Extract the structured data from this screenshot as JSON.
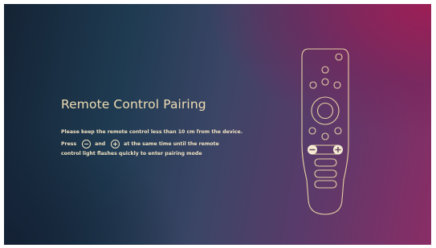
{
  "screen": {
    "title": "Remote Control Pairing",
    "instructions": {
      "line1": "Please keep the remote control less than 10 cm from the device.",
      "line2_before": "Press",
      "line2_between": "and",
      "line2_after": "at the same time until the remote",
      "line3": "control light flashes quickly to enter pairing mode"
    },
    "icons": {
      "minus": "minus-circle-icon",
      "plus": "plus-circle-icon",
      "remote": "remote-control-illustration"
    }
  },
  "colors": {
    "text": "#f1e2c2",
    "title": "#f0deb4",
    "remote_outline": "#e6cfa3",
    "background_left": "#1f3b52",
    "background_right": "#8a2d66"
  }
}
